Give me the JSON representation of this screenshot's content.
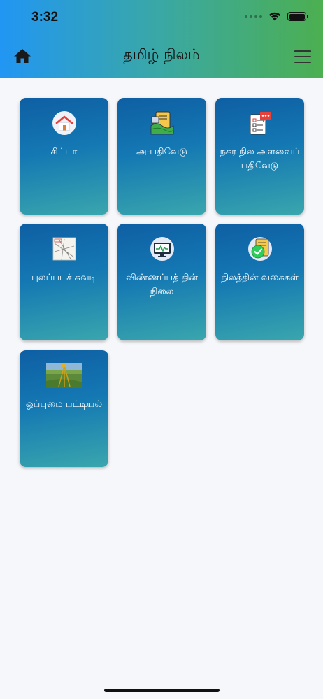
{
  "status_bar": {
    "time": "3:32"
  },
  "header": {
    "title": "தமிழ் நிலம்"
  },
  "cards": [
    {
      "label": "சிட்டா",
      "icon": "house-icon"
    },
    {
      "label": "அ-பதிவேடு",
      "icon": "land-document-icon"
    },
    {
      "label": "நகர நில அளவைப் பதிவேடு",
      "icon": "checklist-chat-icon"
    },
    {
      "label": "புலப்படச் சுவடி",
      "icon": "map-sketch-icon"
    },
    {
      "label": "விண்ணப்பத் தின் நிலை",
      "icon": "monitor-status-icon"
    },
    {
      "label": "நிலத்தின் வகைகள்",
      "icon": "approved-document-icon"
    },
    {
      "label": "ஒப்புமை பட்டியல்",
      "icon": "field-photo-icon"
    }
  ]
}
